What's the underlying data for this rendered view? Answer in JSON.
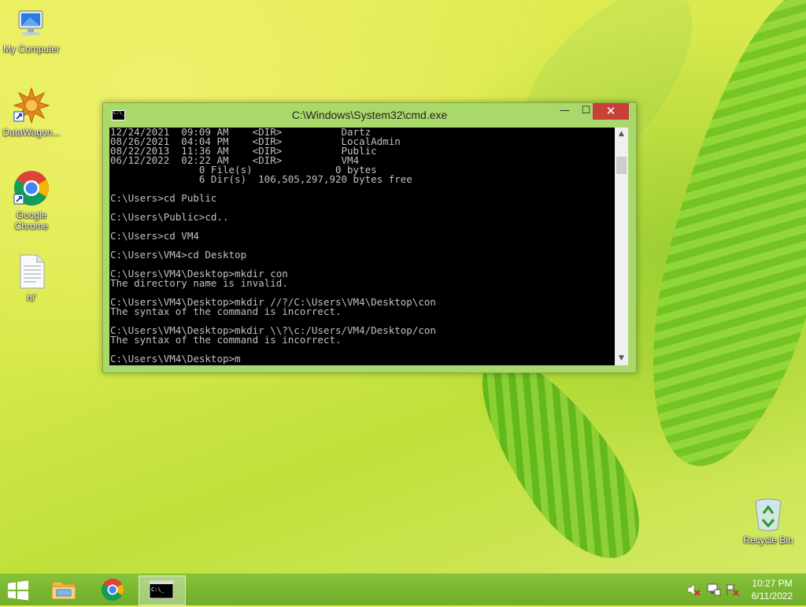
{
  "desktop": {
    "icons": [
      {
        "label": "My Computer",
        "icon": "monitor-icon"
      },
      {
        "label": "DataWagon...",
        "icon": "datawagon-icon"
      },
      {
        "label": "Google\nChrome",
        "label_line1": "Google",
        "label_line2": "Chrome",
        "icon": "chrome-icon"
      },
      {
        "label": "hi'",
        "icon": "text-file-icon"
      },
      {
        "label": "Recycle Bin",
        "icon": "recycle-bin-icon"
      }
    ]
  },
  "cmd_window": {
    "title": "C:\\Windows\\System32\\cmd.exe",
    "minimize_glyph": "—",
    "maximize_glyph": "☐",
    "close_glyph": "✕",
    "console_text": "12/24/2021  09:09 AM    <DIR>          Dartz\n08/26/2021  04:04 PM    <DIR>          LocalAdmin\n08/22/2013  11:36 AM    <DIR>          Public\n06/12/2022  02:22 AM    <DIR>          VM4\n               0 File(s)              0 bytes\n               6 Dir(s)  106,505,297,920 bytes free\n\nC:\\Users>cd Public\n\nC:\\Users\\Public>cd..\n\nC:\\Users>cd VM4\n\nC:\\Users\\VM4>cd Desktop\n\nC:\\Users\\VM4\\Desktop>mkdir con\nThe directory name is invalid.\n\nC:\\Users\\VM4\\Desktop>mkdir //?/C:\\Users\\VM4\\Desktop\\con\nThe syntax of the command is incorrect.\n\nC:\\Users\\VM4\\Desktop>mkdir \\\\?\\c:/Users/VM4/Desktop/con\nThe syntax of the command is incorrect.\n\nC:\\Users\\VM4\\Desktop>m"
  },
  "taskbar": {
    "items": [
      "start-button",
      "file-explorer",
      "google-chrome",
      "command-prompt"
    ],
    "clock_time": "10:27 PM",
    "clock_date": "6/11/2022",
    "colors": {
      "bar": "#78b632",
      "active": "#c8e79a"
    }
  }
}
